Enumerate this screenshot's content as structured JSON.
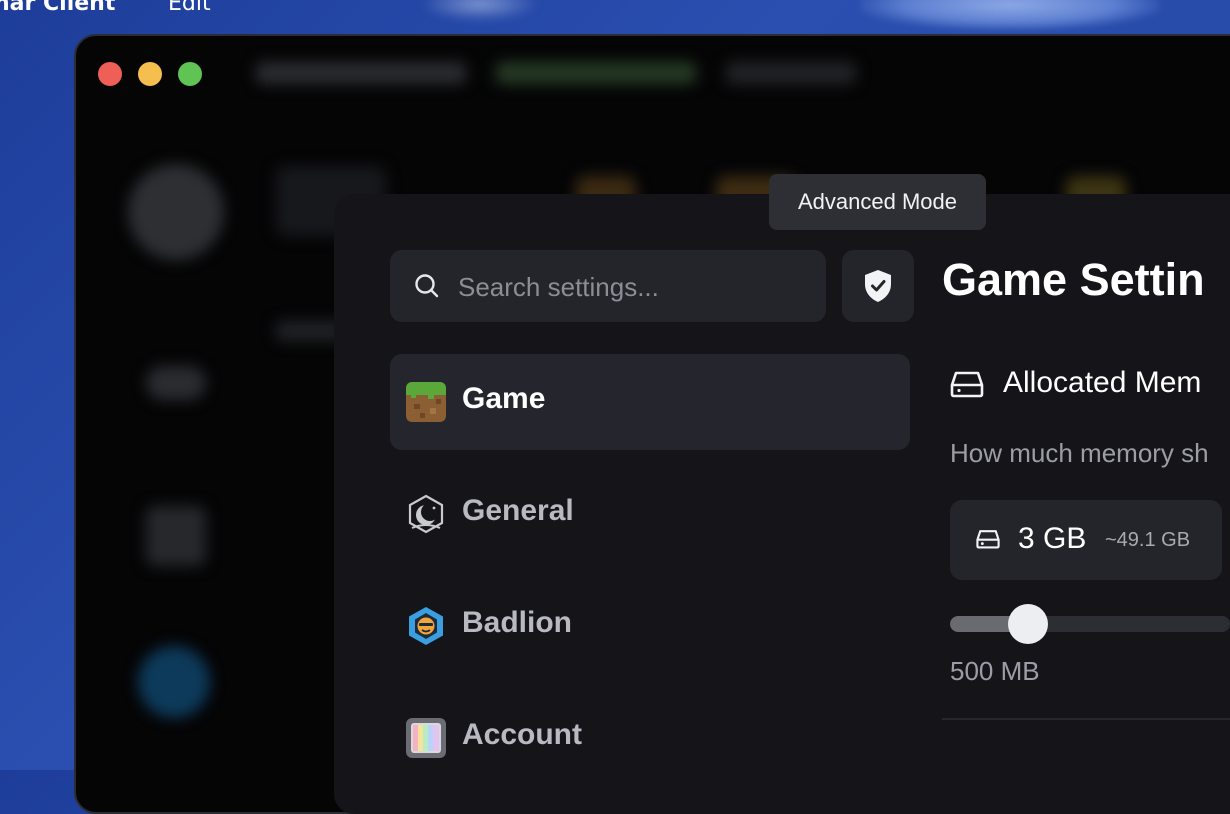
{
  "menubar": {
    "app_name": "nar Client",
    "edit": "Edit"
  },
  "tooltip": {
    "text": "Advanced Mode"
  },
  "search": {
    "placeholder": "Search settings..."
  },
  "nav": {
    "items": [
      {
        "label": "Game",
        "icon": "minecraft-grass-icon",
        "active": true
      },
      {
        "label": "General",
        "icon": "moon-logo-icon",
        "active": false
      },
      {
        "label": "Badlion",
        "icon": "badlion-lion-icon",
        "active": false
      },
      {
        "label": "Account",
        "icon": "account-avatar-icon",
        "active": false
      }
    ]
  },
  "main": {
    "title": "Game Settin",
    "section": {
      "heading": "Allocated Mem",
      "description": "How much memory sh",
      "value": "3 GB",
      "approx": "~49.1 GB",
      "slider_min_label": "500 MB",
      "slider_fraction": 0.28
    }
  },
  "colors": {
    "panel_bg": "#151519",
    "field_bg": "#24252b",
    "active_nav_bg": "#25262d",
    "accent_red": "#ee5f57",
    "accent_yellow": "#f6be4f",
    "accent_green": "#5fc453"
  }
}
